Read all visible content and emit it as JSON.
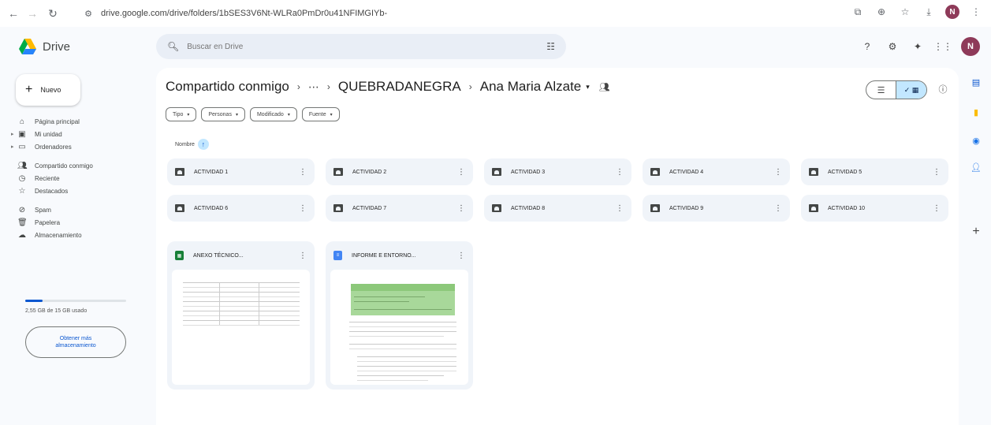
{
  "browser": {
    "url": "drive.google.com/drive/folders/1bSES3V6Nt-WLRa0PmDr0u41NFIMGIYb-",
    "avatar_letter": "N"
  },
  "app": {
    "name": "Drive",
    "search_placeholder": "Buscar en Drive",
    "avatar_letter": "N"
  },
  "sidebar": {
    "new_label": "Nuevo",
    "items": [
      {
        "label": "Página principal",
        "icon": "home-icon"
      },
      {
        "label": "Mi unidad",
        "icon": "my-drive-icon"
      },
      {
        "label": "Ordenadores",
        "icon": "computers-icon"
      },
      {
        "label": "Compartido conmigo",
        "icon": "shared-icon"
      },
      {
        "label": "Reciente",
        "icon": "clock-icon"
      },
      {
        "label": "Destacados",
        "icon": "star-icon"
      },
      {
        "label": "Spam",
        "icon": "spam-icon"
      },
      {
        "label": "Papelera",
        "icon": "trash-icon"
      },
      {
        "label": "Almacenamiento",
        "icon": "cloud-icon"
      }
    ],
    "storage_text": "2,55 GB de 15 GB usado",
    "storage_fraction": 0.17,
    "get_storage_line1": "Obtener más",
    "get_storage_line2": "almacenamiento"
  },
  "breadcrumb": {
    "root": "Compartido conmigo",
    "ellipsis": "⋯",
    "middle": "QUEBRADANEGRA",
    "current": "Ana Maria Alzate"
  },
  "filters": [
    "Tipo",
    "Personas",
    "Modificado",
    "Fuente"
  ],
  "sort_label": "Nombre",
  "folders": [
    "ACTIVIDAD 1",
    "ACTIVIDAD 2",
    "ACTIVIDAD 3",
    "ACTIVIDAD 4",
    "ACTIVIDAD 5",
    "ACTIVIDAD 6",
    "ACTIVIDAD 7",
    "ACTIVIDAD 8",
    "ACTIVIDAD 9",
    "ACTIVIDAD 10"
  ],
  "files": [
    {
      "name": "ANEXO TÉCNICO...",
      "type": "sheets",
      "color": "#188038"
    },
    {
      "name": "INFORME E ENTORNO...",
      "type": "docs",
      "color": "#4285f4"
    }
  ],
  "colors": {
    "accent": "#0b57d0",
    "selected": "#c2e7ff",
    "card": "#f0f4f9"
  }
}
